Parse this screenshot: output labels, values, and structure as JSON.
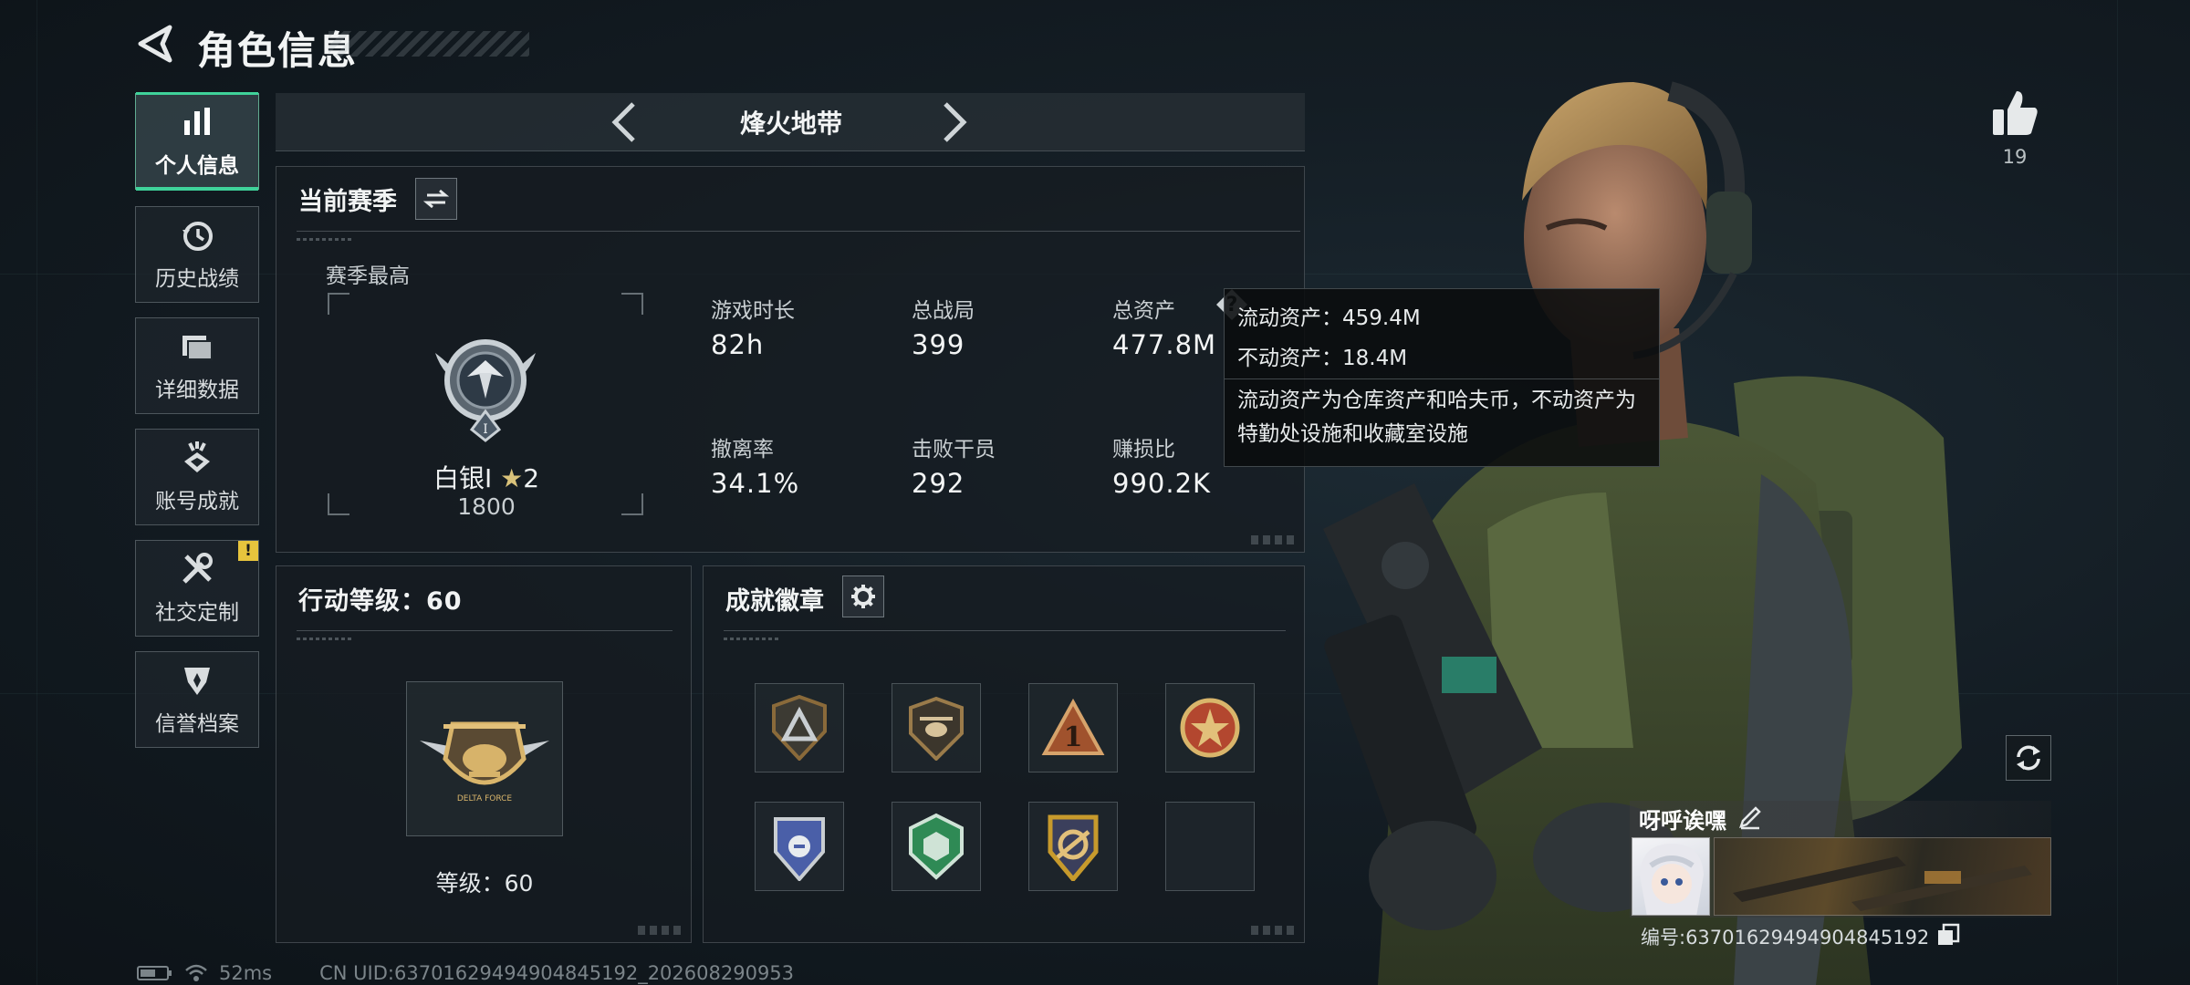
{
  "header": {
    "title": "角色信息"
  },
  "nav": {
    "items": [
      {
        "label": "个人信息",
        "icon": "bar-chart-icon",
        "active": true
      },
      {
        "label": "历史战绩",
        "icon": "history-clock-icon",
        "active": false
      },
      {
        "label": "详细数据",
        "icon": "folder-icon",
        "active": false
      },
      {
        "label": "账号成就",
        "icon": "achievement-icon",
        "active": false
      },
      {
        "label": "社交定制",
        "icon": "tools-icon",
        "active": false,
        "badge": "!"
      },
      {
        "label": "信誉档案",
        "icon": "reputation-icon",
        "active": false
      }
    ]
  },
  "mode": {
    "name": "烽火地带"
  },
  "season": {
    "title": "当前赛季",
    "best_label": "赛季最高",
    "rank_name": "白银Ⅰ",
    "rank_stars": "2",
    "rank_points": "1800",
    "stats": [
      {
        "label": "游戏时长",
        "value": "82h"
      },
      {
        "label": "总战局",
        "value": "399"
      },
      {
        "label": "总资产",
        "value": "477.8M",
        "has_help": true
      },
      {
        "label": "撤离率",
        "value": "34.1%"
      },
      {
        "label": "击败干员",
        "value": "292"
      },
      {
        "label": "赚损比",
        "value": "990.2K"
      }
    ],
    "help_symbol": "?"
  },
  "tooltip": {
    "liquid": "流动资产：459.4M",
    "fixed": "不动资产：18.4M",
    "desc": "流动资产为仓库资产和哈夫币，不动资产为特勤处设施和收藏室设施"
  },
  "level": {
    "title": "行动等级：60",
    "caption": "等级：60",
    "emblem_text": "DELTA FORCE"
  },
  "badges": {
    "title": "成就徽章",
    "slots": [
      {
        "icon": "triangle-shield-badge-icon",
        "filled": true,
        "color": "#8a6a3a"
      },
      {
        "icon": "helicopter-badge-icon",
        "filled": true,
        "color": "#9a7b4a"
      },
      {
        "icon": "number-one-badge-icon",
        "filled": true,
        "color": "#a0522d"
      },
      {
        "icon": "star-roundel-badge-icon",
        "filled": true,
        "color": "#b3472f"
      },
      {
        "icon": "blue-shield-badge-icon",
        "filled": true,
        "color": "#4a5fa8"
      },
      {
        "icon": "green-hex-badge-icon",
        "filled": true,
        "color": "#2f8a55"
      },
      {
        "icon": "gold-crest-badge-icon",
        "filled": true,
        "color": "#c79a2c"
      },
      {
        "icon": "empty-slot",
        "filled": false
      }
    ]
  },
  "profile": {
    "likes": "19",
    "name": "呀呼诶嘿",
    "id_text": "编号:637016294949048451​92"
  },
  "status": {
    "ping": "52ms",
    "uid": "CN UID:6370162949490484519​2_202608290953"
  },
  "colors": {
    "accent": "#3fd29a",
    "warning_badge": "#e7c43d"
  }
}
